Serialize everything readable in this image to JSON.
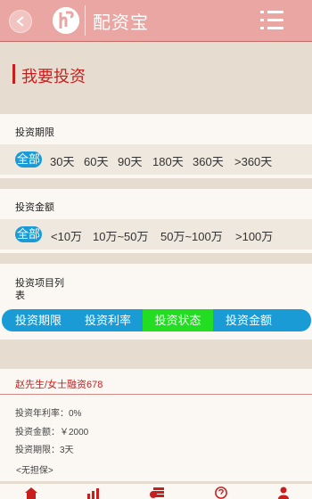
{
  "header": {
    "title": "配资宝"
  },
  "page": {
    "title": "我要投资"
  },
  "term_section": {
    "label": "投资期限",
    "all": "全部",
    "options": [
      "30天",
      "60天",
      "90天",
      "180天",
      "360天",
      ">360天"
    ]
  },
  "amount_section": {
    "label": "投资金额",
    "all": "全部",
    "options": [
      "<10万",
      "10万~50万",
      "50万~100万",
      ">100万"
    ]
  },
  "project_list": {
    "label_line1": "投资项目列",
    "label_line2": "表",
    "tabs": [
      {
        "label": "投资期限",
        "active": false
      },
      {
        "label": "投资利率",
        "active": false
      },
      {
        "label": "投资状态",
        "active": true
      },
      {
        "label": "投资金额",
        "active": false
      }
    ]
  },
  "listing": {
    "title": "赵先生/女士融资678",
    "rate": "投资年利率：0%",
    "amount": "投资金额：￥2000",
    "term": "投资期限：3天",
    "guarantee": "<无担保>"
  },
  "bottom_nav": {
    "icons": [
      "home-icon",
      "chart-icon",
      "money-icon",
      "help-icon",
      "user-icon"
    ]
  },
  "colors": {
    "header_bg": "#e9a6a2",
    "accent_red": "#c81e1e",
    "accent_blue": "#1a9bd6",
    "active_green": "#22dd22"
  }
}
